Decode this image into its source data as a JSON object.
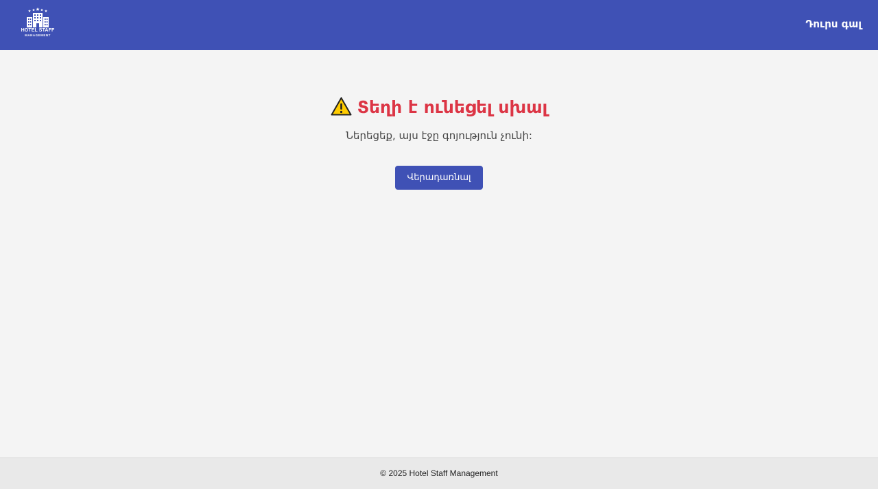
{
  "header": {
    "logo": {
      "line1": "HOTEL STAFF",
      "line2": "MANAGEMENT"
    },
    "logout_label": "Դուրս գալ"
  },
  "error": {
    "icon": "warning-icon",
    "title": "Տեղի է ունեցել սխալ",
    "message": "Ներեցեք, այս էջը գոյություն չունի:",
    "back_label": "Վերադառնալ",
    "title_color": "#dc3545"
  },
  "footer": {
    "copyright": "© 2025 Hotel Staff Management"
  },
  "colors": {
    "brand": "#3f51b5",
    "background": "#f4f4f4",
    "footer_bg": "#e9e9e9"
  }
}
